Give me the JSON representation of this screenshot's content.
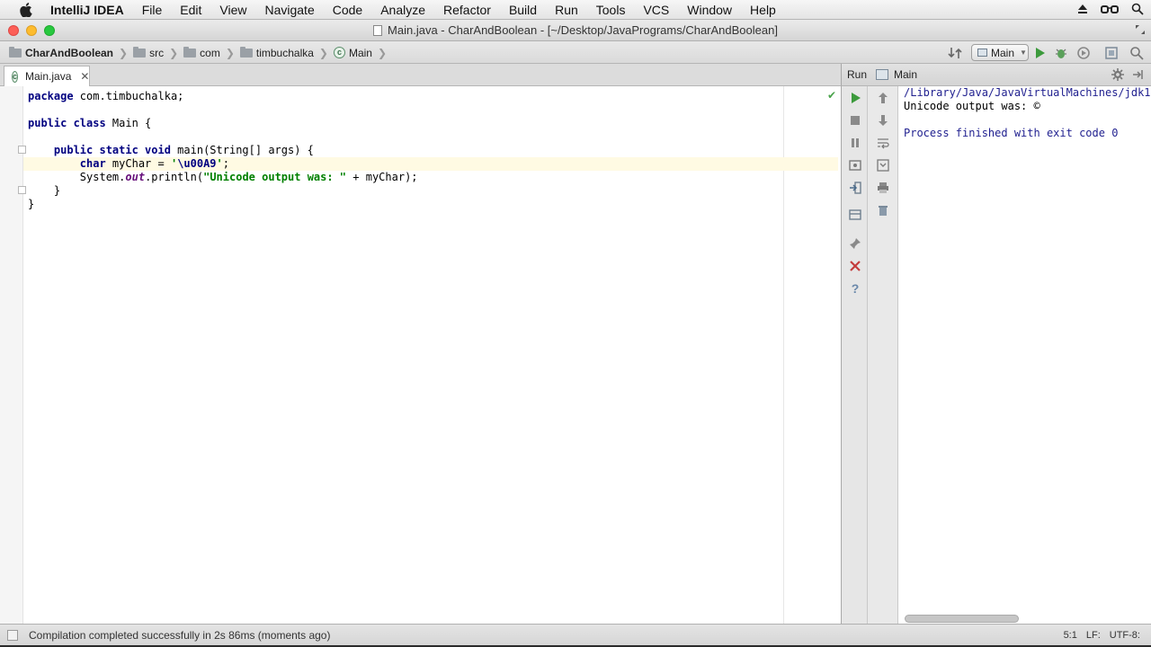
{
  "menubar": {
    "app_name": "IntelliJ IDEA",
    "items": [
      "File",
      "Edit",
      "View",
      "Navigate",
      "Code",
      "Analyze",
      "Refactor",
      "Build",
      "Run",
      "Tools",
      "VCS",
      "Window",
      "Help"
    ]
  },
  "window": {
    "title": "Main.java - CharAndBoolean - [~/Desktop/JavaPrograms/CharAndBoolean]"
  },
  "breadcrumbs": [
    "CharAndBoolean",
    "src",
    "com",
    "timbuchalka",
    "Main"
  ],
  "run_config": {
    "label": "Main"
  },
  "editor": {
    "tab_label": "Main.java",
    "lines": [
      {
        "segments": [
          {
            "t": "package",
            "c": "kw"
          },
          {
            "t": " com.timbuchalka;",
            "c": ""
          }
        ]
      },
      {
        "segments": []
      },
      {
        "segments": [
          {
            "t": "public class",
            "c": "kw"
          },
          {
            "t": " Main {",
            "c": ""
          }
        ]
      },
      {
        "segments": []
      },
      {
        "segments": [
          {
            "t": "    ",
            "c": ""
          },
          {
            "t": "public static void",
            "c": "kw"
          },
          {
            "t": " main(String[] args) {",
            "c": ""
          }
        ]
      },
      {
        "current": true,
        "segments": [
          {
            "t": "        ",
            "c": ""
          },
          {
            "t": "char",
            "c": "kw"
          },
          {
            "t": " myChar = ",
            "c": ""
          },
          {
            "t": "'",
            "c": "str"
          },
          {
            "t": "\\u00A9",
            "c": "esc"
          },
          {
            "t": "'",
            "c": "str"
          },
          {
            "t": ";",
            "c": ""
          }
        ]
      },
      {
        "segments": [
          {
            "t": "        System.",
            "c": ""
          },
          {
            "t": "out",
            "c": "static-field"
          },
          {
            "t": ".println(",
            "c": ""
          },
          {
            "t": "\"Unicode output was: \"",
            "c": "str"
          },
          {
            "t": " + myChar);",
            "c": ""
          }
        ]
      },
      {
        "segments": [
          {
            "t": "    }",
            "c": ""
          }
        ]
      },
      {
        "segments": [
          {
            "t": "}",
            "c": ""
          }
        ]
      }
    ]
  },
  "run_panel": {
    "header_label": "Run",
    "tab_label": "Main",
    "console_lines": [
      {
        "text": "/Library/Java/JavaVirtualMachines/jdk1",
        "color": "#1f1f8f"
      },
      {
        "text": "Unicode output was: ©",
        "color": "#000000"
      },
      {
        "text": "",
        "color": "#000000"
      },
      {
        "text": "Process finished with exit code 0",
        "color": "#1f1f8f"
      }
    ]
  },
  "status": {
    "message": "Compilation completed successfully in 2s 86ms (moments ago)",
    "position": "5:1",
    "line_sep": "LF:",
    "encoding": "UTF-8:"
  },
  "icons": {
    "apple": "apple-icon",
    "run": "run-icon",
    "stop": "stop-icon",
    "pause": "pause-icon",
    "close": "close-icon"
  },
  "colors": {
    "keyword": "#000080",
    "string": "#008000",
    "run_green": "#3c9a3c",
    "stop_red": "#c43c3c"
  }
}
